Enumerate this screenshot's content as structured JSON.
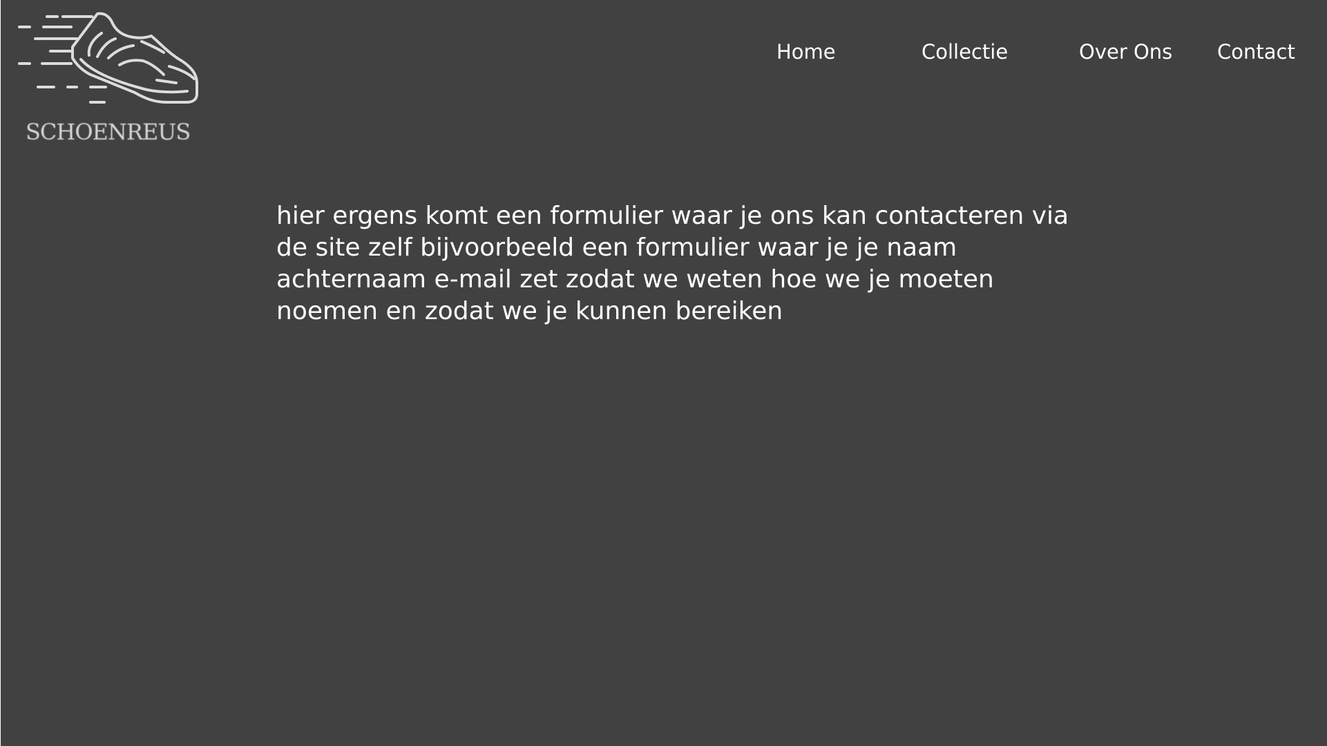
{
  "header": {
    "logo": {
      "icon": "running-shoe-icon",
      "brand_text": "SCHOENREUS"
    },
    "nav": {
      "home": "Home",
      "collectie": "Collectie",
      "over_ons": "Over Ons",
      "contact": "Contact"
    }
  },
  "main": {
    "body_text": "hier ergens komt een formulier waar je ons kan contacteren via de site zelf bijvoorbeeld een formulier waar je je naam achternaam e-mail zet zodat we weten hoe we je moeten noemen en zodat we je kunnen bereiken"
  },
  "colors": {
    "background": "#414141",
    "text": "#ffffff",
    "logo": "#d6d6d6"
  }
}
